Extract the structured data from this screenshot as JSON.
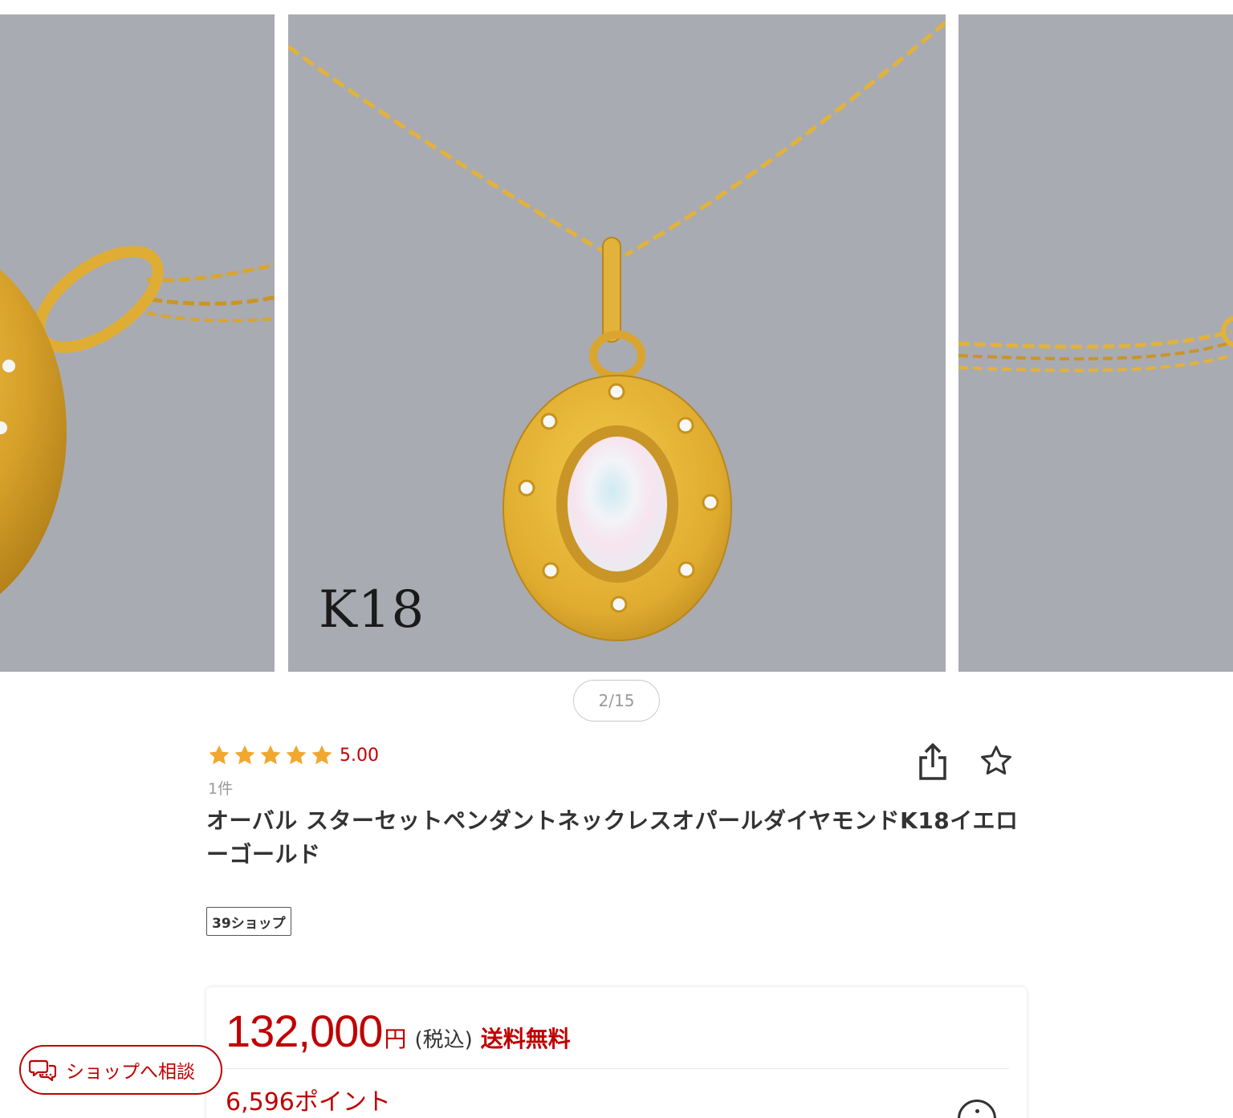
{
  "gallery": {
    "slide_current_overlay": "K18",
    "pager": "2/15"
  },
  "product": {
    "rating": 5.0,
    "rating_label": "5.00",
    "review_count_label": "1件",
    "title": "オーバル スターセットペンダントネックレスオパールダイヤモンドK18イエローゴールド",
    "shop_badge": "39ショップ",
    "share_icon": "share-icon",
    "favorite_icon": "star-outline-icon"
  },
  "price": {
    "amount": "132,000",
    "yen": "円",
    "tax": "(税込)",
    "shipping": "送料無料",
    "points": "6,596ポイント",
    "info_icon": "info-icon"
  },
  "consult": {
    "label": "ショップへ相談",
    "icon": "chat-bubbles-icon"
  },
  "colors": {
    "accent": "#bf0000",
    "star": "#f0a830",
    "photo_bg": "#a9abb2",
    "gold": "#e2b23a"
  }
}
